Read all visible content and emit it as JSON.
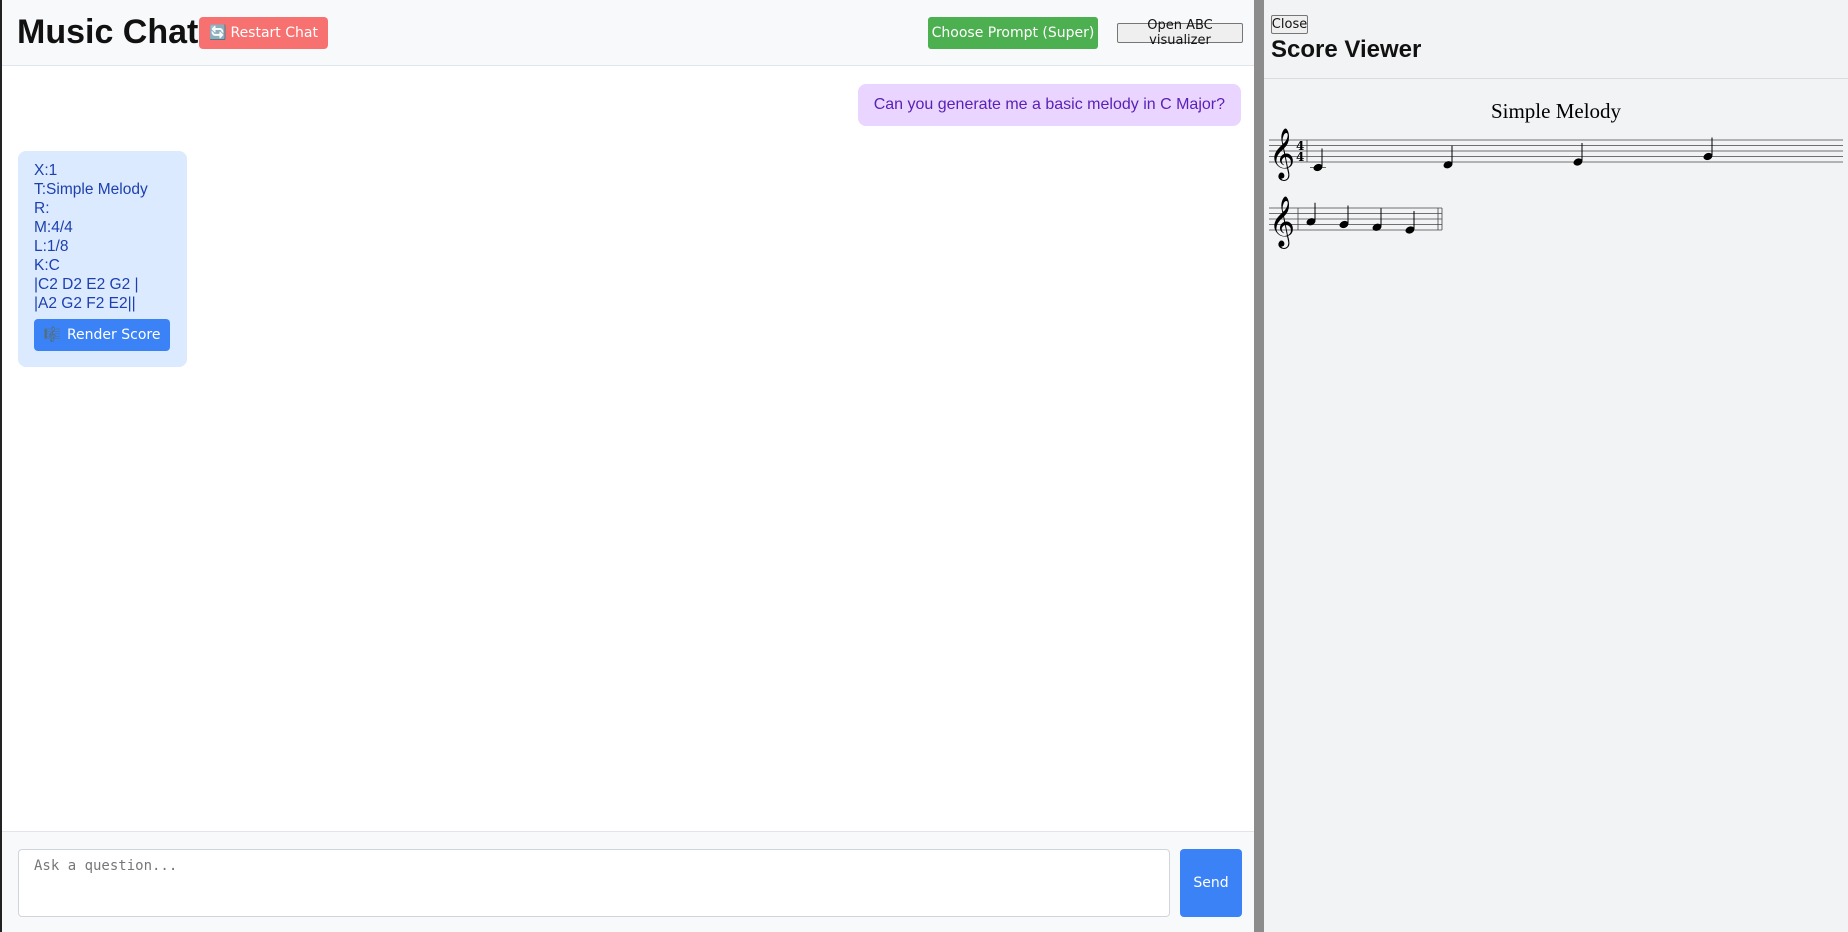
{
  "header": {
    "title": "Music Chat",
    "restart_icon": "restart-icon",
    "restart_glyph": "🔄",
    "restart_label": "Restart Chat",
    "prompt_label": "Choose Prompt (Super)",
    "abc_label": "Open ABC visualizer"
  },
  "messages": {
    "user": "Can you generate me a basic melody in C Major?",
    "bot_lines": [
      "X:1",
      "T:Simple Melody",
      "R:",
      "M:4/4",
      "L:1/8",
      "K:C",
      "|C2 D2 E2 G2 |",
      "|A2 G2 F2 E2||"
    ],
    "render_icon": "music-note-icon",
    "render_glyph": "🎼",
    "render_label": "Render Score"
  },
  "composer": {
    "placeholder": "Ask a question...",
    "send_label": "Send"
  },
  "score_viewer": {
    "close_label": "Close",
    "title": "Score Viewer",
    "sheet_title": "Simple Melody",
    "time_signature": [
      "4",
      "4"
    ],
    "staves": [
      {
        "notes": [
          "C",
          "D",
          "E",
          "G"
        ]
      },
      {
        "notes": [
          "A",
          "G",
          "F",
          "E"
        ]
      }
    ]
  }
}
